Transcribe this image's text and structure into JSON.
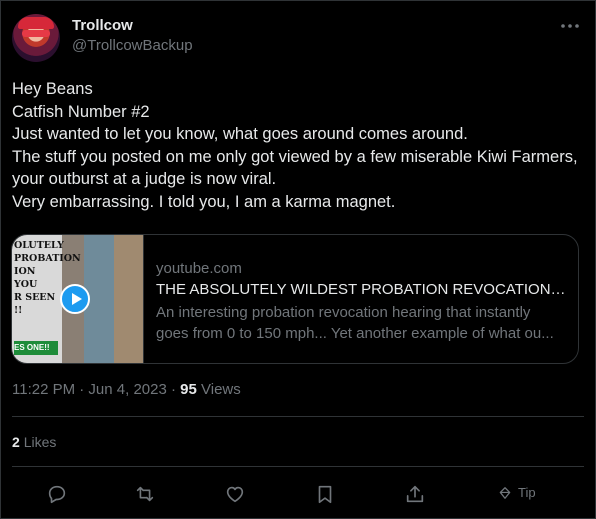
{
  "tweet": {
    "display_name": "Trollcow",
    "handle": "@TrollcowBackup",
    "text": "Hey Beans\nCatfish Number #2\nJust wanted to let you know, what goes around comes around.\nThe stuff you posted on me only got viewed by a few miserable Kiwi Farmers, your outburst at a judge is now viral.\nVery embarrassing. I told you, I am a karma magnet.",
    "time": "11:22 PM · Jun 4, 2023 ·",
    "views_count": "95",
    "views_label": "Views",
    "likes_count": "2",
    "likes_label": "Likes"
  },
  "card": {
    "domain": "youtube.com",
    "title": "THE ABSOLUTELY WILDEST PROBATION REVOCATION Y...",
    "description_line1": "An interesting probation revocation hearing that instantly",
    "description_line2": "goes from 0 to 150 mph... Yet another example of what ou...",
    "thumb_text": "OLUTELY\nPROBATION\nION YOU\nR SEEN !!",
    "thumb_badge": "ES ONE!!"
  },
  "actions": {
    "tip_label": "Tip"
  },
  "colors": {
    "background": "#000000",
    "text": "#e7e9ea",
    "secondary": "#71767b",
    "border": "#2f3336",
    "accent": "#1d9bf0"
  },
  "icons": [
    "more-icon",
    "reply-icon",
    "retweet-icon",
    "like-icon",
    "bookmark-icon",
    "share-icon",
    "tip-icon",
    "play-icon"
  ]
}
